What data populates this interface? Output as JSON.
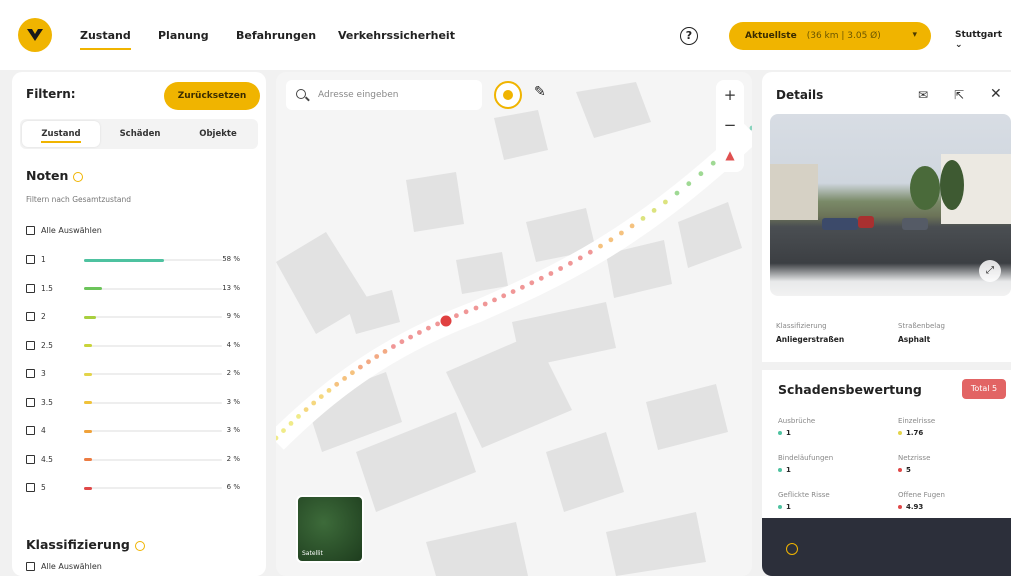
{
  "nav": {
    "items": [
      "Zustand",
      "Planung",
      "Befahrungen",
      "Verkehrssicherheit"
    ],
    "help_icon": "?",
    "topical_label": "Aktuellste",
    "topical_sub": "(36 km | 3.05 Ø)",
    "city": "Stuttgart",
    "accent_color": "#f0b400"
  },
  "filter": {
    "title": "Filtern:",
    "reset_label": "Zurücksetzen",
    "tabs": [
      "Zustand",
      "Schäden",
      "Objekte"
    ],
    "section_title": "Noten",
    "section_sub": "Filtern nach Gesamtzustand",
    "select_all": "Alle Auswählen",
    "grades": [
      {
        "label": "1",
        "percent": 58,
        "pct_text": "58 %",
        "color": "#4ec2a0"
      },
      {
        "label": "1.5",
        "percent": 13,
        "pct_text": "13 %",
        "color": "#6cc45a"
      },
      {
        "label": "2",
        "percent": 9,
        "pct_text": "9 %",
        "color": "#a8cf3e"
      },
      {
        "label": "2.5",
        "percent": 4,
        "pct_text": "4 %",
        "color": "#c9d43a"
      },
      {
        "label": "3",
        "percent": 2,
        "pct_text": "2 %",
        "color": "#e3d44a"
      },
      {
        "label": "3.5",
        "percent": 3,
        "pct_text": "3 %",
        "color": "#f0c23a"
      },
      {
        "label": "4",
        "percent": 3,
        "pct_text": "3 %",
        "color": "#f0a23a"
      },
      {
        "label": "4.5",
        "percent": 2,
        "pct_text": "2 %",
        "color": "#ec7c42"
      },
      {
        "label": "5",
        "percent": 6,
        "pct_text": "6 %",
        "color": "#e04848"
      }
    ],
    "section2_title": "Klassifizierung",
    "section2_select_all": "Alle Auswählen"
  },
  "map": {
    "search_placeholder": "Adresse eingeben",
    "zoom_in": "+",
    "zoom_out": "−",
    "satellite_label": "Satellit"
  },
  "details": {
    "title": "Details",
    "classification_label": "Klassifizierung",
    "classification_value": "Anliegerstraßen",
    "surface_label": "Straßenbelag",
    "surface_value": "Asphalt",
    "damage_title": "Schadensbewertung",
    "total_label": "Total 5",
    "damages": [
      {
        "label": "Ausbrüche",
        "value": "1",
        "color": "#4ec2a0"
      },
      {
        "label": "Einzelrisse",
        "value": "1.76",
        "color": "#e3d44a"
      },
      {
        "label": "Bindeläufungen",
        "value": "1",
        "color": "#4ec2a0"
      },
      {
        "label": "Netzrisse",
        "value": "5",
        "color": "#e04848"
      },
      {
        "label": "Geflickte Risse",
        "value": "1",
        "color": "#4ec2a0"
      },
      {
        "label": "Offene Fugen",
        "value": "4.93",
        "color": "#e04848"
      }
    ]
  }
}
